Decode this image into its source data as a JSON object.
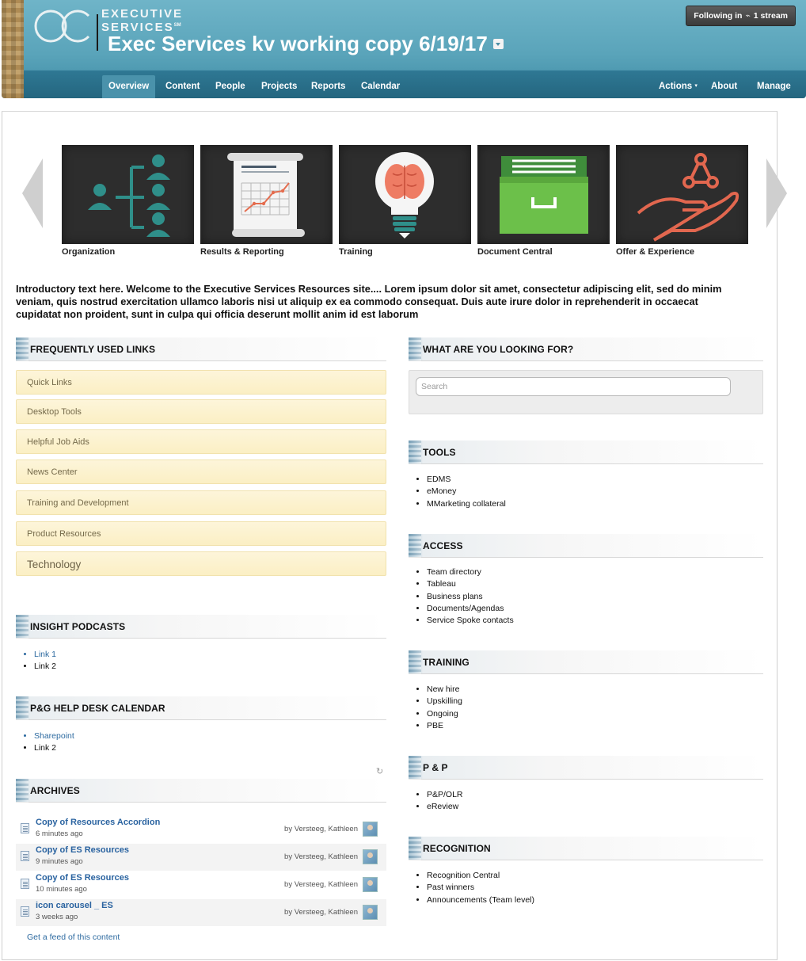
{
  "header": {
    "logo_text_line1": "EXECUTIVE",
    "logo_text_line2": "SERVICES",
    "logo_sm": "SM",
    "site_title": "Exec Services kv working copy 6/19/17",
    "following_prefix": "Following in",
    "following_suffix": "1 stream"
  },
  "nav": {
    "left": [
      "Overview",
      "Content",
      "People",
      "Projects",
      "Reports",
      "Calendar"
    ],
    "active": "Overview",
    "right": {
      "actions": "Actions",
      "about": "About",
      "manage": "Manage"
    }
  },
  "carousel": {
    "tiles": [
      {
        "label": "Organization",
        "icon": "org-chart-icon"
      },
      {
        "label": "Results & Reporting",
        "icon": "report-chart-icon"
      },
      {
        "label": "Training",
        "icon": "brain-bulb-icon"
      },
      {
        "label": "Document Central",
        "icon": "file-drawer-icon"
      },
      {
        "label": "Offer & Experience",
        "icon": "hand-network-icon"
      }
    ]
  },
  "intro": "Introductory text here. Welcome to the Executive Services Resources site.... Lorem ipsum dolor sit amet, consectetur adipiscing elit, sed do minim veniam, quis nostrud exercitation ullamco laboris nisi ut aliquip ex ea commodo consequat. Duis aute irure dolor in reprehenderit in occaecat cupidatat non proident, sunt in culpa qui officia deserunt mollit anim id est laborum",
  "left": {
    "frequent_title": "FREQUENTLY USED LINKS",
    "frequent_items": [
      "Quick Links",
      "Desktop Tools",
      "Helpful Job Aids",
      "News Center",
      "Training and Development",
      "Product Resources",
      "Technology"
    ],
    "podcasts_title": "INSIGHT PODCASTS",
    "podcasts_items": [
      "Link 1",
      "Link 2"
    ],
    "calendar_title": "P&G HELP DESK CALENDAR",
    "calendar_items": [
      "Sharepoint",
      "Link 2"
    ],
    "archives_title": "ARCHIVES",
    "archives": [
      {
        "title": "Copy of Resources Accordion",
        "time": "6 minutes ago",
        "by": "by Versteeg, Kathleen"
      },
      {
        "title": "Copy of ES Resources",
        "time": "9 minutes ago",
        "by": "by Versteeg, Kathleen"
      },
      {
        "title": "Copy of ES Resources",
        "time": "10 minutes ago",
        "by": "by Versteeg, Kathleen"
      },
      {
        "title": "icon carousel _ ES",
        "time": "3 weeks ago",
        "by": "by Versteeg, Kathleen"
      }
    ],
    "feed_link": "Get a feed of this content"
  },
  "right": {
    "search_title": "WHAT ARE YOU LOOKING FOR?",
    "search_placeholder": "Search",
    "tools_title": "TOOLS",
    "tools_items": [
      "EDMS",
      "eMoney",
      "MMarketing collateral"
    ],
    "access_title": "ACCESS",
    "access_items": [
      "Team directory",
      "Tableau",
      "Business plans",
      "Documents/Agendas",
      "Service Spoke contacts"
    ],
    "training_title": "TRAINING",
    "training_items": [
      "New hire",
      "Upskilling",
      "Ongoing",
      "PBE"
    ],
    "pp_title": "P & P",
    "pp_items": [
      "P&P/OLR",
      "eReview"
    ],
    "recognition_title": "RECOGNITION",
    "recognition_items": [
      "Recognition Central",
      "Past winners",
      "Announcements (Team level)"
    ]
  },
  "colors": {
    "header_teal": "#5aa4ba",
    "navbar": "#2a6f8a",
    "accordion": "#fbefc4",
    "link_blue": "#2d6aa0"
  }
}
